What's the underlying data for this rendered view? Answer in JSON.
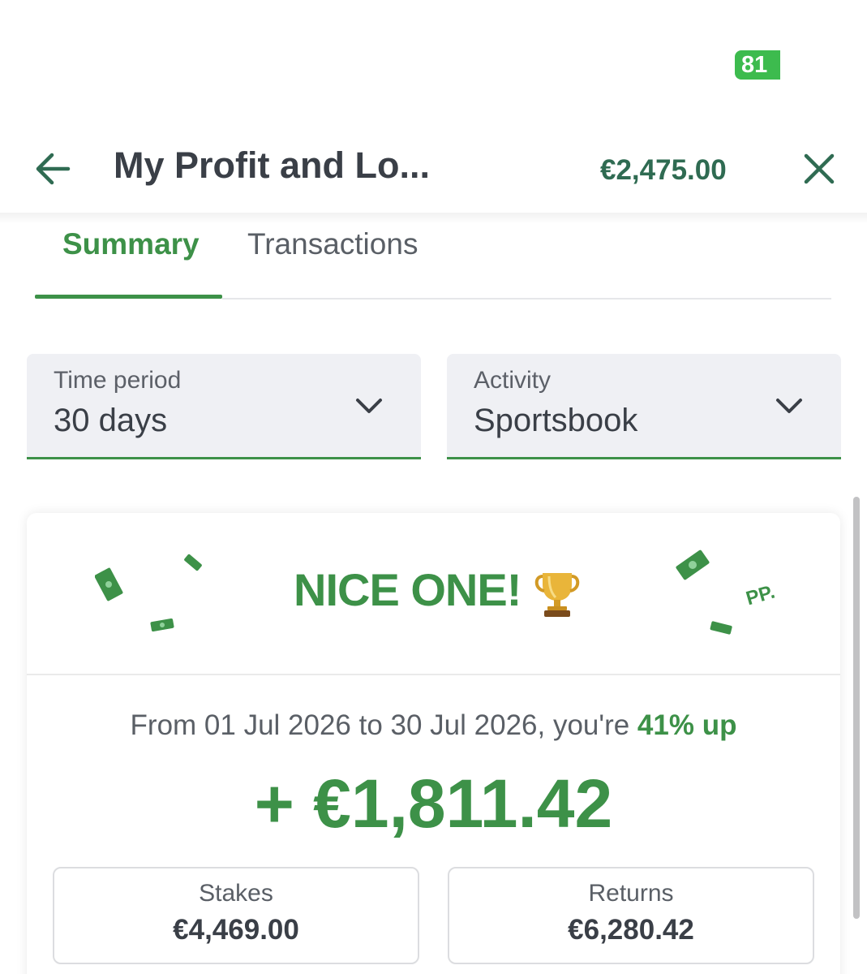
{
  "status_bar": {
    "battery": "81"
  },
  "header": {
    "title": "My Profit and Lo...",
    "balance": "€2,475.00",
    "icons": {
      "back": "arrow-left-icon",
      "close": "close-icon"
    }
  },
  "tabs": [
    {
      "label": "Summary",
      "active": true
    },
    {
      "label": "Transactions",
      "active": false
    }
  ],
  "filters": {
    "time_period": {
      "label": "Time period",
      "value": "30 days"
    },
    "activity": {
      "label": "Activity",
      "value": "Sportsbook"
    }
  },
  "summary": {
    "banner_text": "NICE ONE!",
    "banner_tag": "PP.",
    "period_prefix": "From 01 Jul 2026 to 30 Jul 2026, you're ",
    "period_pct": "41% up",
    "profit": "+ €1,811.42",
    "stakes": {
      "label": "Stakes",
      "value": "€4,469.00"
    },
    "returns": {
      "label": "Returns",
      "value": "€6,280.42"
    }
  },
  "colors": {
    "accent_green": "#3d9148",
    "balance_green": "#2f6b52",
    "text_dark": "#3a3f47",
    "field_bg": "#eff0f4",
    "battery_green": "#3dbb4e"
  }
}
